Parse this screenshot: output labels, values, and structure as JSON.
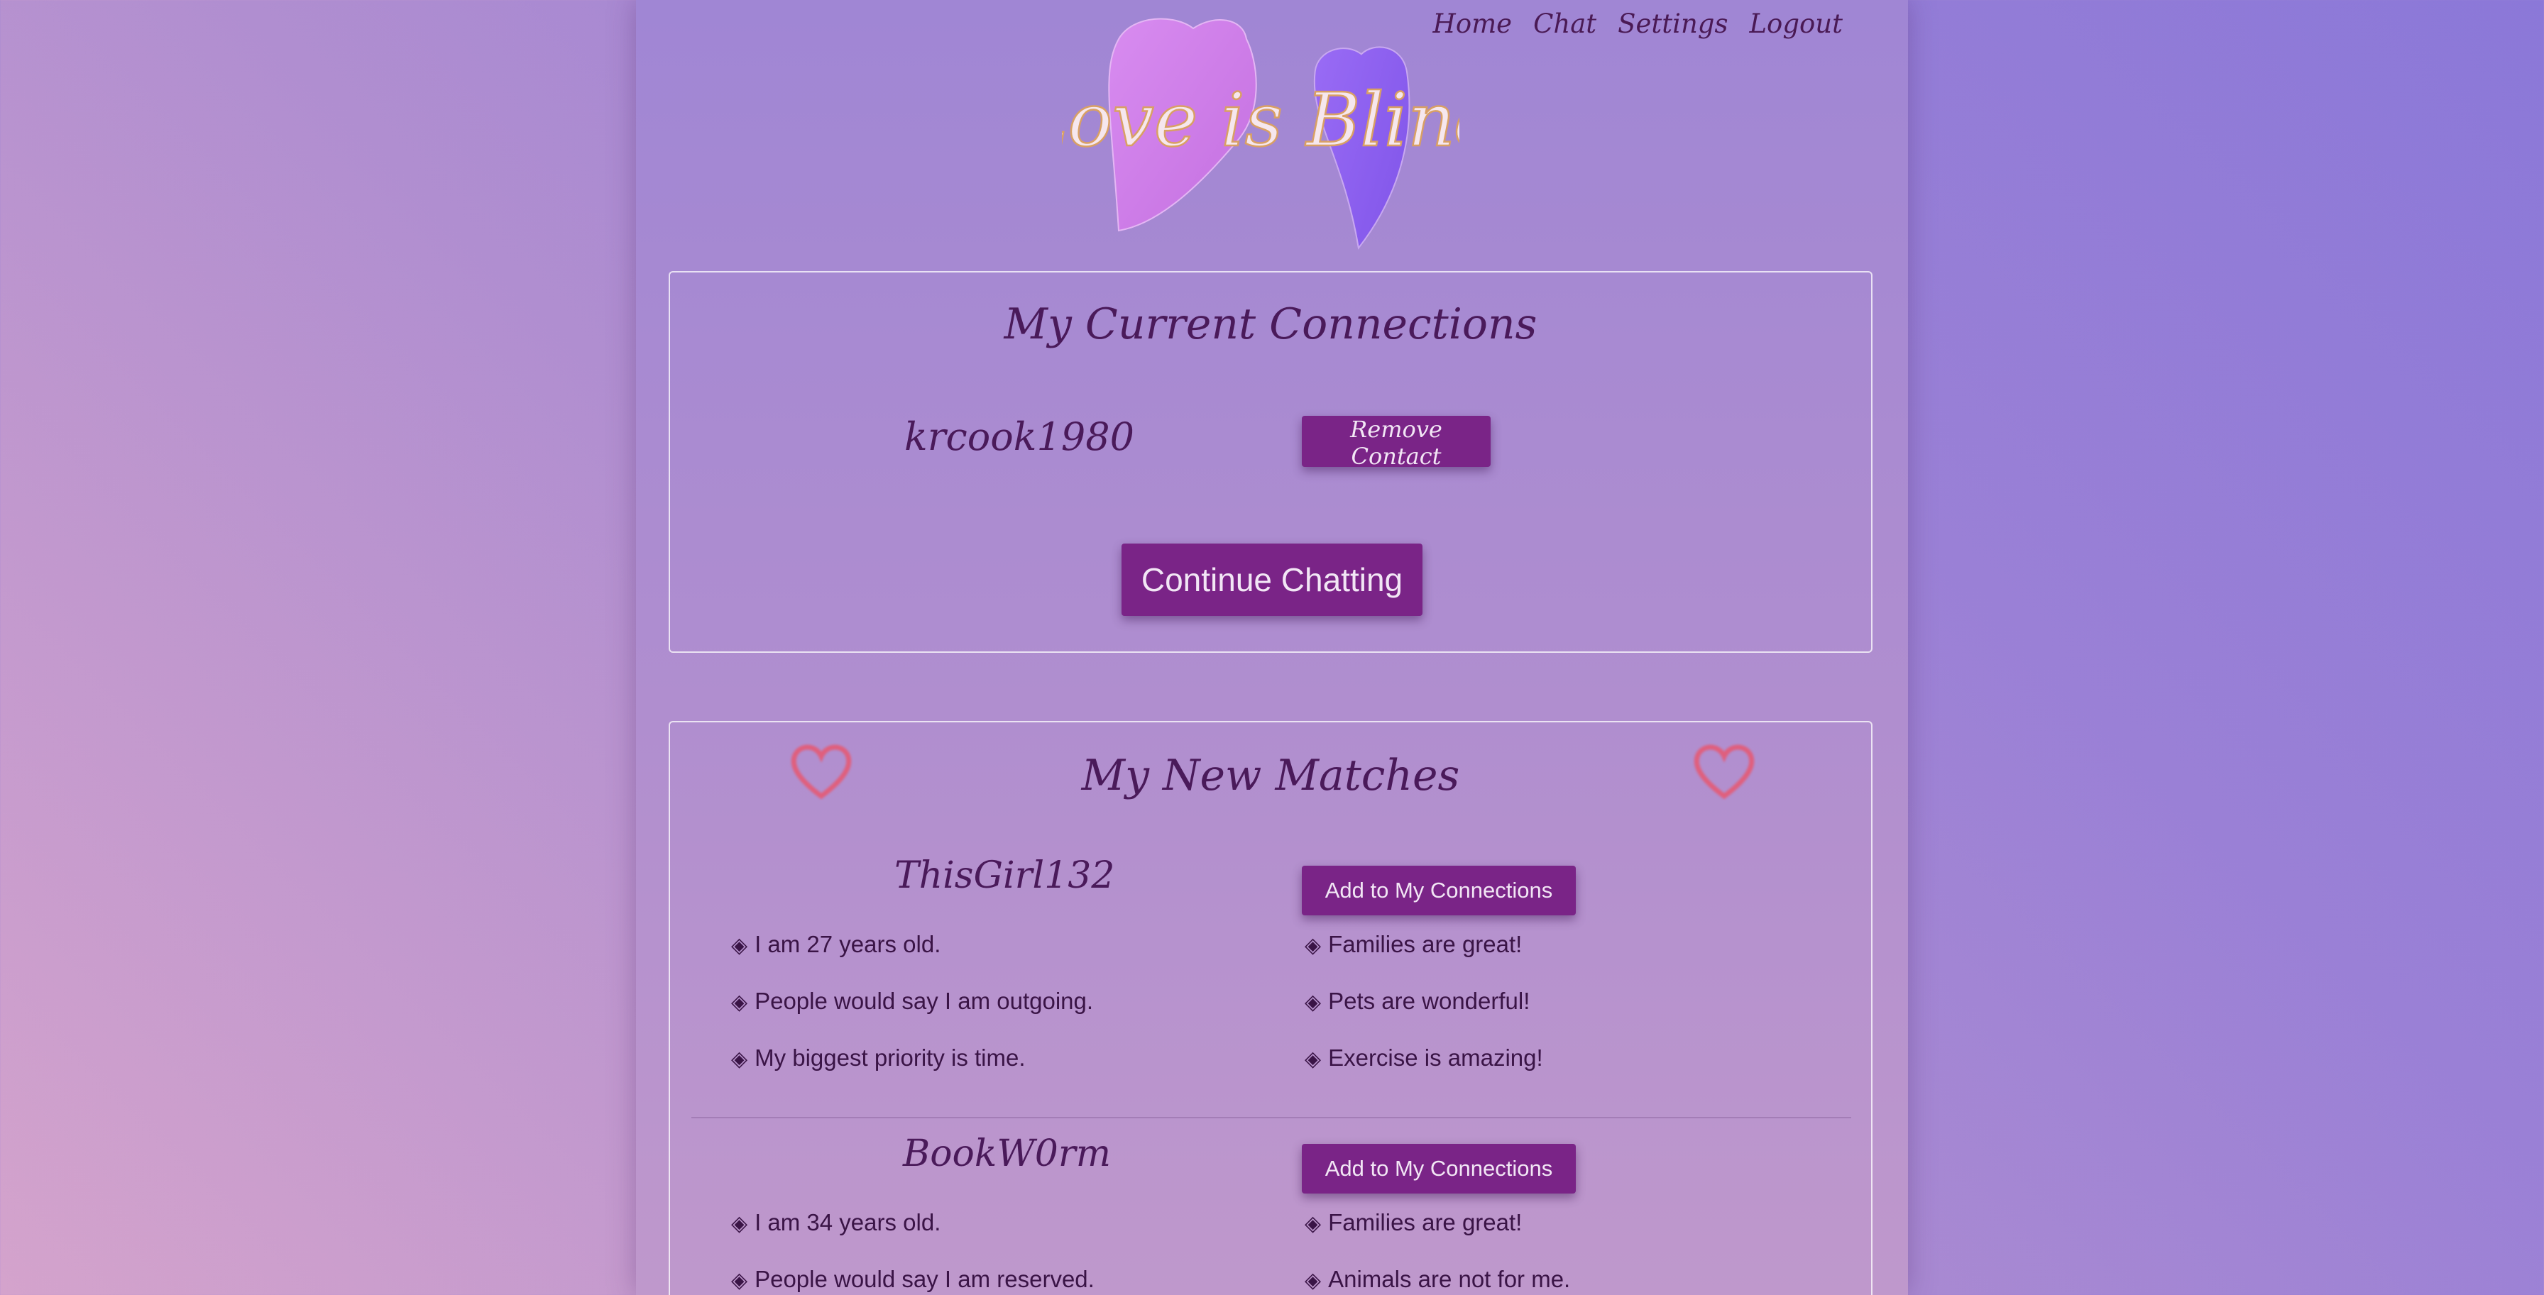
{
  "nav": {
    "items": [
      "Home",
      "Chat",
      "Settings",
      "Logout"
    ]
  },
  "logo": {
    "text": "Love is Blind",
    "colors": {
      "left_heart": "#cb7ee8",
      "right_heart": "#8c5ef0",
      "text_fill": "#f6e7ee",
      "text_stroke": "#e0a86a"
    }
  },
  "connections": {
    "title": "My Current Connections",
    "contacts": [
      {
        "username": "krcook1980",
        "remove_label": "Remove Contact"
      }
    ],
    "continue_label": "Continue Chatting"
  },
  "matches": {
    "title": "My New Matches",
    "heart_icon": "heart-icon",
    "heart_color": "#e8576f",
    "items": [
      {
        "username": "ThisGirl132",
        "add_label": "Add to My Connections",
        "traits_left": [
          "I am 27 years old.",
          "People would say I am outgoing.",
          "My biggest priority is time."
        ],
        "traits_right": [
          "Families are great!",
          "Pets are wonderful!",
          "Exercise is amazing!"
        ]
      },
      {
        "username": "BookW0rm",
        "add_label": "Add to My Connections",
        "traits_left": [
          "I am 34 years old.",
          "People would say I am reserved."
        ],
        "traits_right": [
          "Families are great!",
          "Animals are not for me."
        ]
      }
    ]
  },
  "colors": {
    "button": "#7a2487",
    "heading": "#4a1a5a",
    "panel_border": "#ffffff"
  }
}
